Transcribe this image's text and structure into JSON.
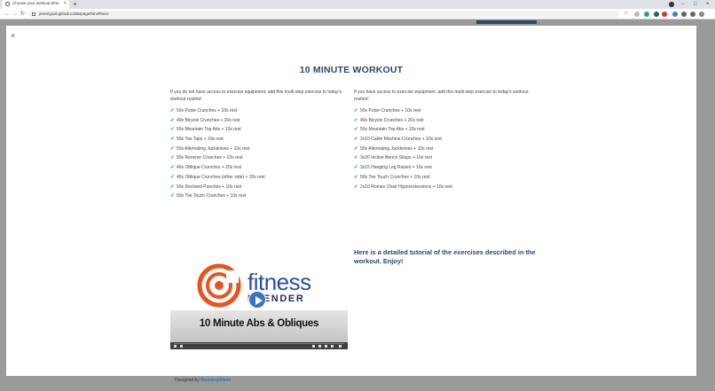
{
  "browser": {
    "tab_title": "Choose your workout time",
    "tab_close": "×",
    "new_tab": "+",
    "url": "jeremypull.github.io/abspage/html#hero",
    "window_controls": [
      "−",
      "□",
      "×"
    ]
  },
  "modal": {
    "close_label": "×",
    "title": "10 MINUTE WORKOUT",
    "left": {
      "intro": "If you do not have access to exercise equipment, add this multi-step exercise to today's workout routine!",
      "items": [
        "50s Pulse Crunches + 10s rest",
        "40s Bicycle Crunches + 20s rest",
        "50s Mountain Top Abs + 10s rest",
        "50s Toe Taps + 10s rest",
        "50s Alternating Jackknives + 10s rest",
        "50s Reverse Crunches + 10s rest",
        "40s Oblique Crunches + 20s rest",
        "40s Oblique Crunches (other side) + 20s rest",
        "50s Reclined Punches + 10s rest",
        "50s Toe Touch Crunches + 10s rest"
      ]
    },
    "right": {
      "intro": "If you have access to exercise equipment, add this multi-step exercise to today's workout routine!",
      "items": [
        "50s Pulse Crunches + 10s rest",
        "40s Bicycle Crunches + 20s rest",
        "50s Mountain Top Abs + 10s rest",
        "2x10 Cable Machine Crunches + 10s rest",
        "50s Alternating Jackknives + 10s rest",
        "3x20 Incline Bench Situps + 10s rest",
        "3x15 Hanging Leg Raises + 10s rest",
        "50s Toe Touch Crunches + 10s rest",
        "2x10 Roman Chair Hyperextensions + 10s rest"
      ]
    },
    "tutorial_text": "Here is a detailed tutorial of the exercises described in the workout. Enjoy!",
    "video": {
      "brand_top": "fitness",
      "brand_bottom": "BLENDER",
      "caption": "10 Minute Abs & Obliques",
      "colors": {
        "logo_orange": "#e8541e",
        "brand_blue": "#2a4fa0",
        "play_blue": "#3a72c4"
      }
    }
  },
  "footer": {
    "prefix": "Designed by",
    "link": "BootstrapMade"
  },
  "colors": {
    "title": "#2a4a6a",
    "check": "#4aa3df",
    "overlay": "#9a9a9a"
  }
}
